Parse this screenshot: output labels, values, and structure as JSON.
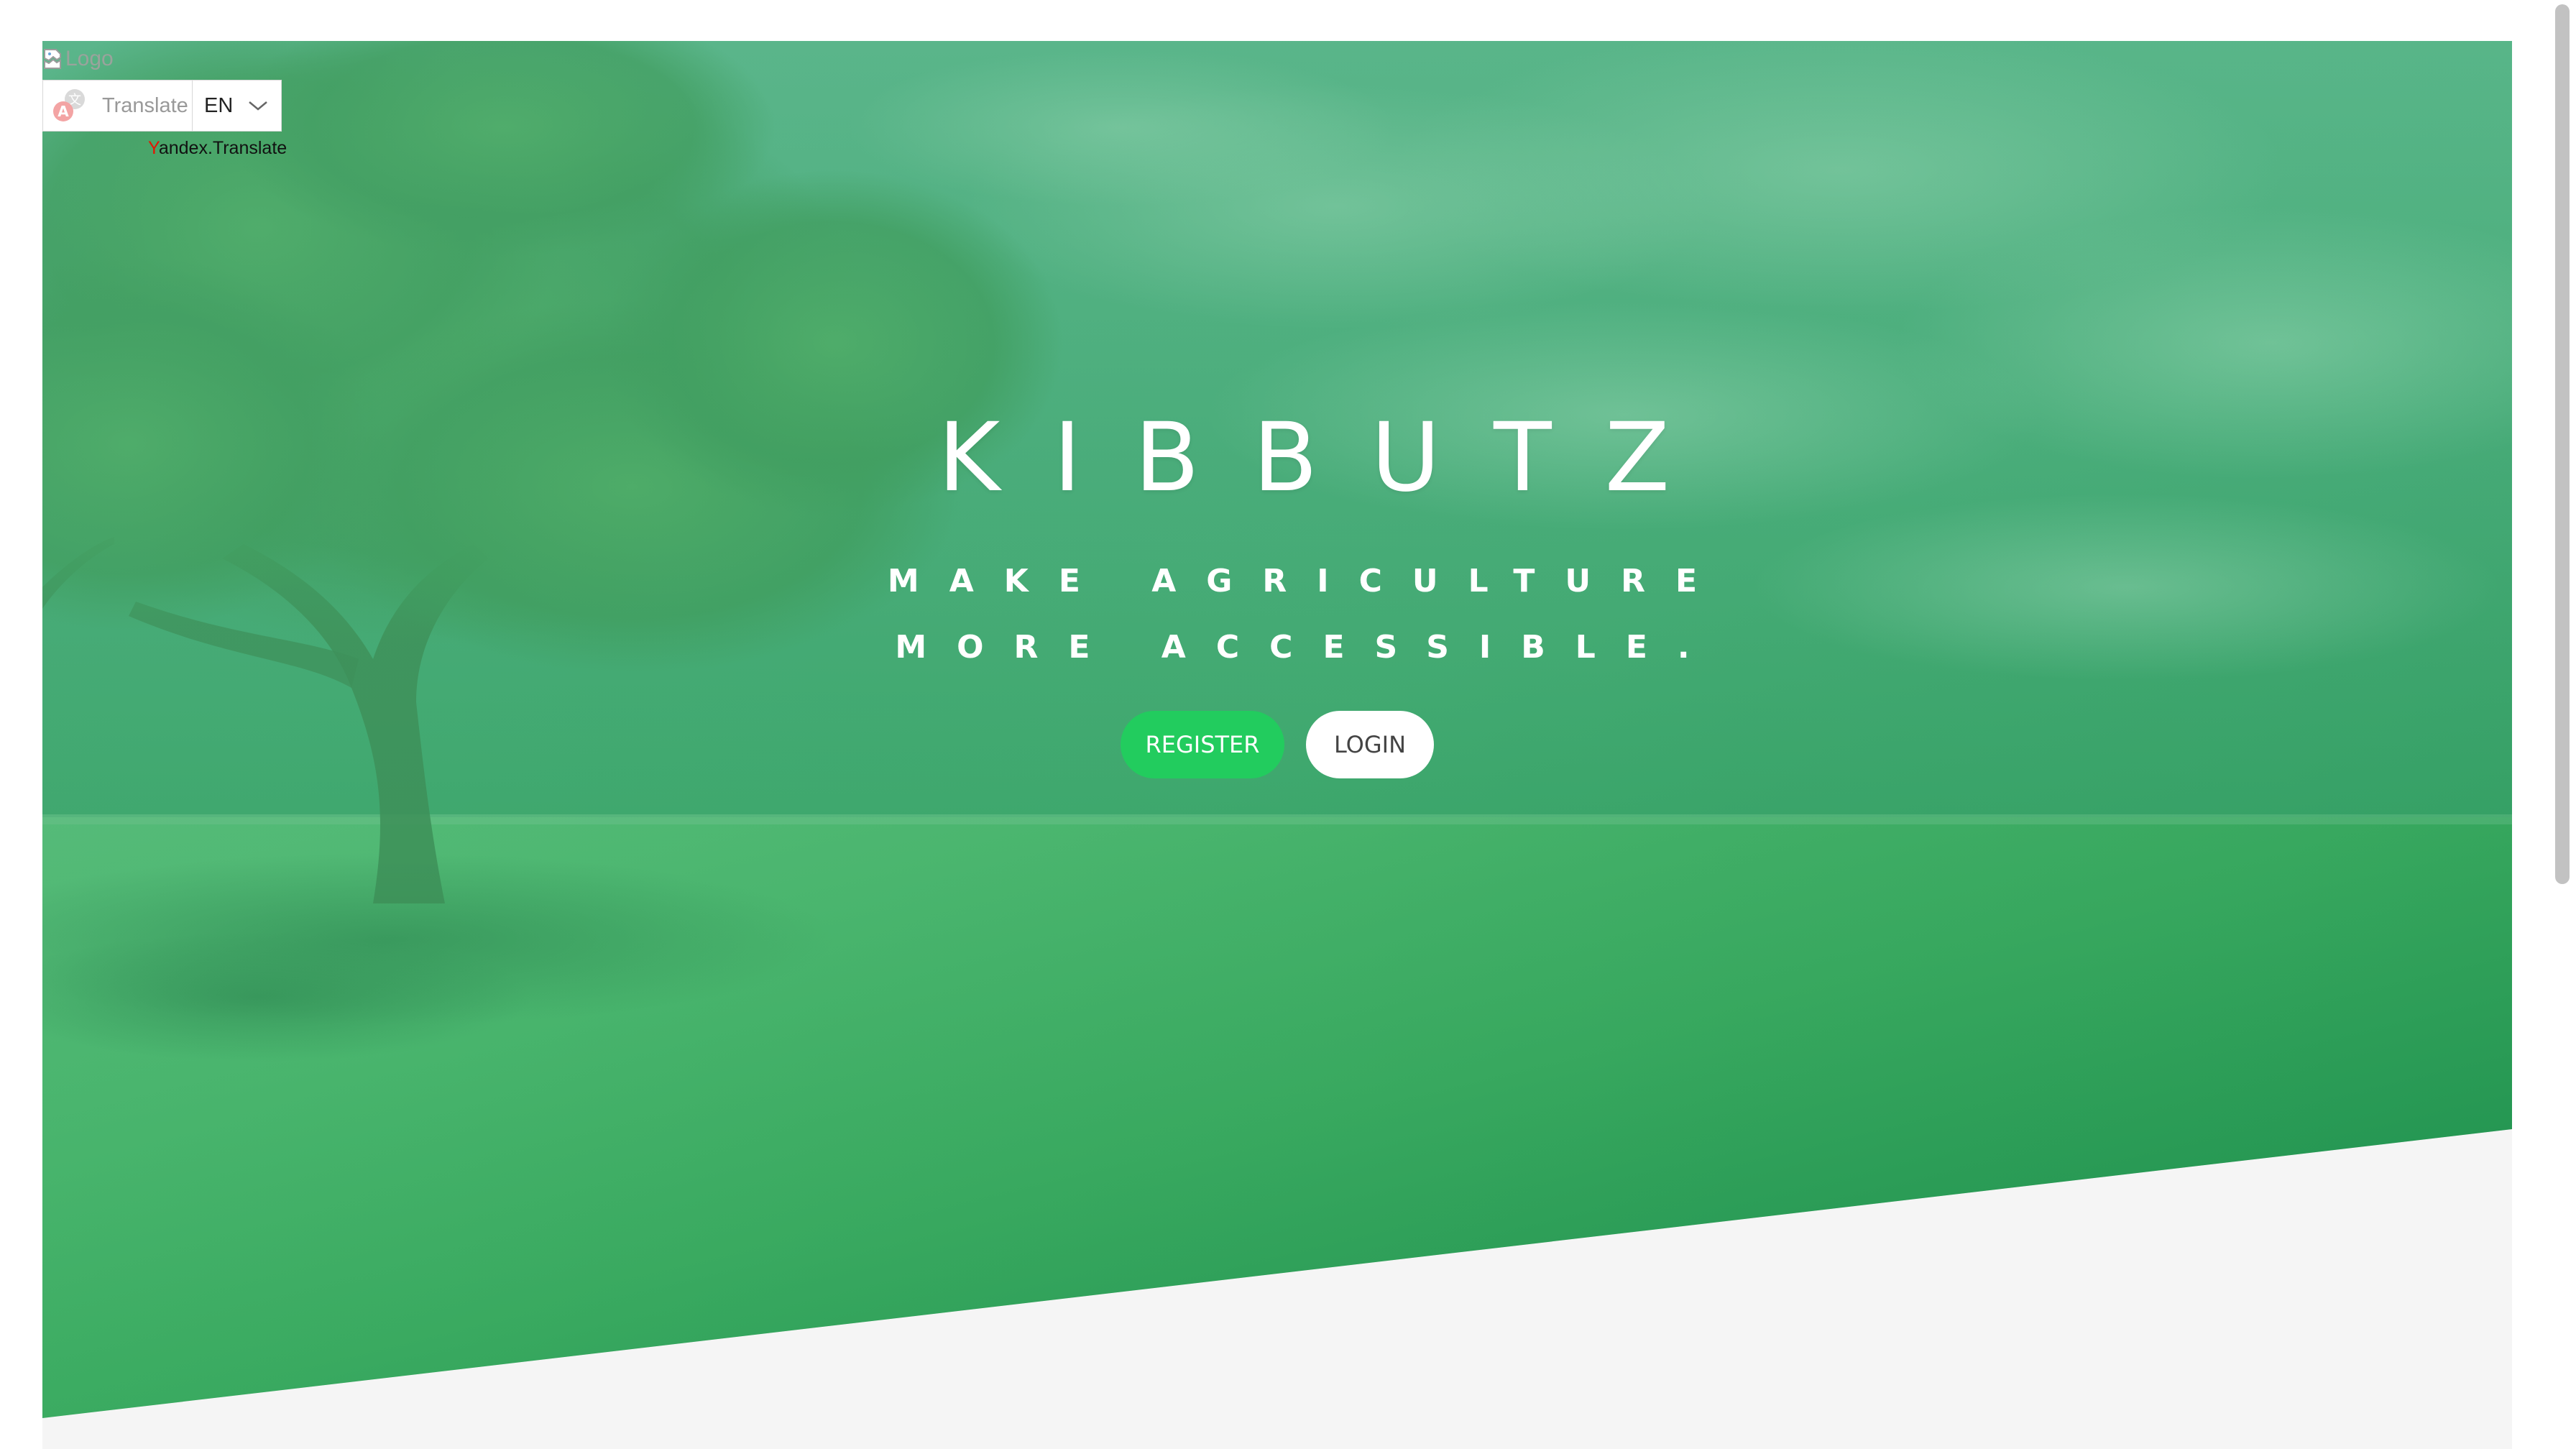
{
  "page": {
    "logo_alt": "Logo"
  },
  "translate": {
    "button_label": "Translate",
    "language": "EN",
    "provider_first_letter": "Y",
    "provider_rest": "andex.Translate"
  },
  "hero": {
    "title": "KIBBUTZ",
    "subtitle": "MAKE AGRICULTURE MORE ACCESSIBLE.",
    "register_label": "REGISTER",
    "login_label": "LOGIN"
  },
  "colors": {
    "register_button": "#22cc5e",
    "hero_green": "#2e9e5e",
    "page_background": "#f5f5f5",
    "yandex_red": "#e61400"
  },
  "icons": [
    "broken-image-icon",
    "translate-icon",
    "chevron-down-icon"
  ]
}
